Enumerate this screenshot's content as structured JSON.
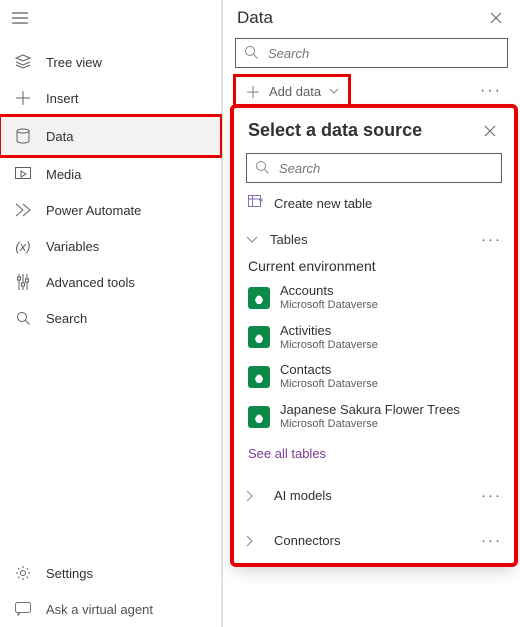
{
  "leftNav": {
    "items": [
      {
        "label": "Tree view"
      },
      {
        "label": "Insert"
      },
      {
        "label": "Data"
      },
      {
        "label": "Media"
      },
      {
        "label": "Power Automate"
      },
      {
        "label": "Variables"
      },
      {
        "label": "Advanced tools"
      },
      {
        "label": "Search"
      }
    ],
    "bottom": [
      {
        "label": "Settings"
      },
      {
        "label": "Ask a virtual agent"
      }
    ]
  },
  "dataPanel": {
    "title": "Data",
    "searchPlaceholder": "Search",
    "addData": "Add data"
  },
  "flyout": {
    "title": "Select a data source",
    "searchPlaceholder": "Search",
    "createNewTable": "Create new table",
    "tablesLabel": "Tables",
    "currentEnv": "Current environment",
    "items": [
      {
        "name": "Accounts",
        "sub": "Microsoft Dataverse"
      },
      {
        "name": "Activities",
        "sub": "Microsoft Dataverse"
      },
      {
        "name": "Contacts",
        "sub": "Microsoft Dataverse"
      },
      {
        "name": "Japanese Sakura Flower Trees",
        "sub": "Microsoft Dataverse"
      }
    ],
    "seeAll": "See all tables",
    "aiModels": "AI models",
    "connectors": "Connectors"
  }
}
